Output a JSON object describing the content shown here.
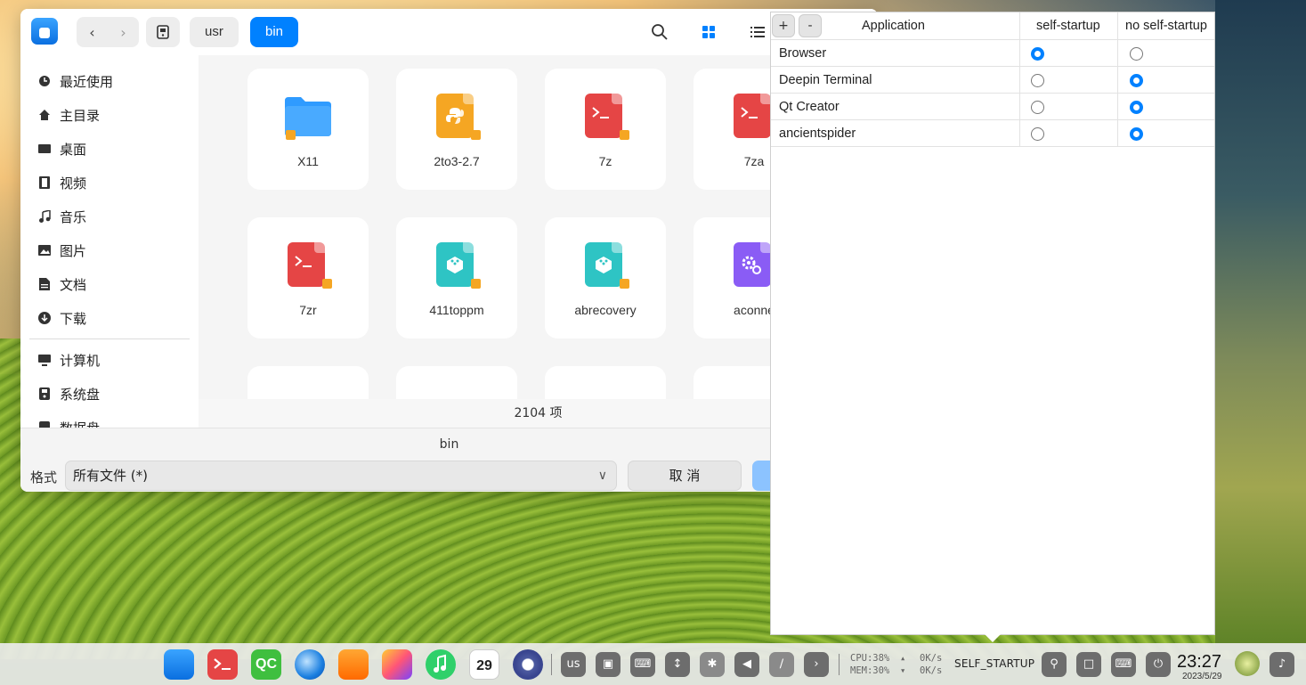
{
  "dialog": {
    "breadcrumb": {
      "usr": "usr",
      "bin": "bin"
    },
    "sidebar": [
      {
        "label": "最近使用",
        "icon": "clock-icon"
      },
      {
        "label": "主目录",
        "icon": "home-icon"
      },
      {
        "label": "桌面",
        "icon": "desktop-icon"
      },
      {
        "label": "视频",
        "icon": "video-icon"
      },
      {
        "label": "音乐",
        "icon": "music-icon"
      },
      {
        "label": "图片",
        "icon": "image-icon"
      },
      {
        "label": "文档",
        "icon": "document-icon"
      },
      {
        "label": "下载",
        "icon": "download-icon"
      },
      {
        "label": "计算机",
        "icon": "computer-icon"
      },
      {
        "label": "系统盘",
        "icon": "disk-icon"
      },
      {
        "label": "数据盘",
        "icon": "disk-icon"
      }
    ],
    "files": [
      {
        "name": "X11",
        "icon": "folder-icon",
        "color": "#2f9bff"
      },
      {
        "name": "2to3-2.7",
        "icon": "python-file-icon",
        "color": "#f5a623"
      },
      {
        "name": "7z",
        "icon": "terminal-file-icon",
        "color": "#e54545"
      },
      {
        "name": "7za",
        "icon": "terminal-file-icon",
        "color": "#e54545"
      },
      {
        "name": "7zr",
        "icon": "terminal-file-icon",
        "color": "#e54545"
      },
      {
        "name": "411toppm",
        "icon": "package-file-icon",
        "color": "#2ec4c4"
      },
      {
        "name": "abrecovery",
        "icon": "package-file-icon",
        "color": "#2ec4c4"
      },
      {
        "name": "aconne",
        "icon": "gear-file-icon",
        "color": "#8a5cf5"
      }
    ],
    "item_count": "2104 项",
    "filename": "bin",
    "format_label": "格式",
    "format_value": "所有文件 (*)",
    "cancel_label": "取 消"
  },
  "startup_panel": {
    "add_label": "+",
    "remove_label": "-",
    "columns": {
      "app": "Application",
      "self": "self-startup",
      "noself": "no self-startup"
    },
    "rows": [
      {
        "name": "Browser",
        "self_startup": true
      },
      {
        "name": "Deepin Terminal",
        "self_startup": false
      },
      {
        "name": "Qt Creator",
        "self_startup": false
      },
      {
        "name": "ancientspider",
        "self_startup": false
      }
    ]
  },
  "dock": {
    "keyboard_layout": "us",
    "cpu": "CPU:38%",
    "mem": "MEM:30%",
    "net_up": "0K/s",
    "net_down": "0K/s",
    "app_label": "SELF_STARTUP",
    "time": "23:27",
    "date": "2023/5/29",
    "calendar_day": "29",
    "qc_label": "QC",
    "accent": "#0081ff"
  }
}
